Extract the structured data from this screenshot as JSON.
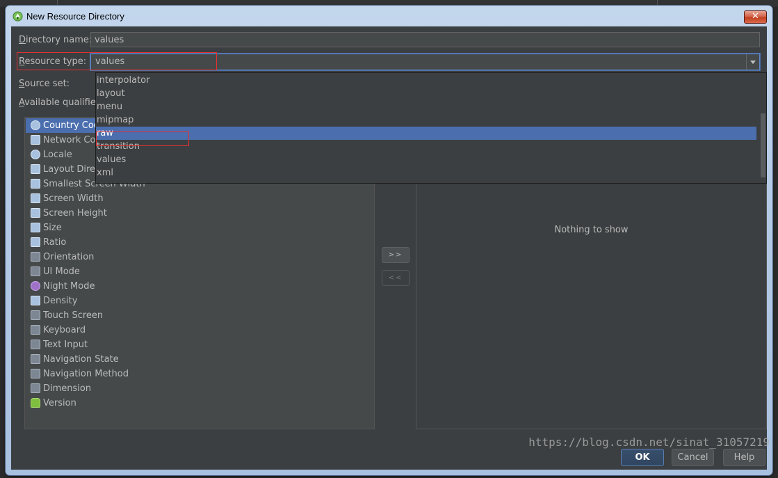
{
  "window": {
    "title": "New Resource Directory",
    "close_label": "✕"
  },
  "form": {
    "directory_name_label": "Directory name:",
    "directory_name_value": "values",
    "resource_type_label": "Resource type:",
    "resource_type_value": "values",
    "source_set_label": "Source set:",
    "available_qualifiers_label": "Available qualifier"
  },
  "dropdown": {
    "items": [
      "interpolator",
      "layout",
      "menu",
      "mipmap",
      "raw",
      "transition",
      "values",
      "xml"
    ],
    "selected": "raw"
  },
  "qualifiers": [
    {
      "label": "Country Code",
      "icon": "globe-pin-icon",
      "selected": true
    },
    {
      "label": "Network Code",
      "icon": "network-icon"
    },
    {
      "label": "Locale",
      "icon": "globe-icon"
    },
    {
      "label": "Layout Direction",
      "icon": "layout-direction-icon"
    },
    {
      "label": "Smallest Screen Width",
      "icon": "smallest-width-icon"
    },
    {
      "label": "Screen Width",
      "icon": "screen-width-icon"
    },
    {
      "label": "Screen Height",
      "icon": "screen-height-icon"
    },
    {
      "label": "Size",
      "icon": "size-icon"
    },
    {
      "label": "Ratio",
      "icon": "ratio-icon"
    },
    {
      "label": "Orientation",
      "icon": "orientation-icon"
    },
    {
      "label": "UI Mode",
      "icon": "ui-mode-icon"
    },
    {
      "label": "Night Mode",
      "icon": "night-mode-icon"
    },
    {
      "label": "Density",
      "icon": "density-icon"
    },
    {
      "label": "Touch Screen",
      "icon": "touch-screen-icon"
    },
    {
      "label": "Keyboard",
      "icon": "keyboard-icon"
    },
    {
      "label": "Text Input",
      "icon": "text-input-icon"
    },
    {
      "label": "Navigation State",
      "icon": "navigation-state-icon"
    },
    {
      "label": "Navigation Method",
      "icon": "navigation-method-icon"
    },
    {
      "label": "Dimension",
      "icon": "dimension-icon"
    },
    {
      "label": "Version",
      "icon": "android-version-icon"
    }
  ],
  "buttons": {
    "add": ">>",
    "remove": "<<",
    "ok": "OK",
    "cancel": "Cancel",
    "help": "Help"
  },
  "chosen": {
    "empty_text": "Nothing to show"
  },
  "watermark": "https://blog.csdn.net/sinat_31057219",
  "colors": {
    "selection": "#4b6eaf",
    "highlight_box": "#e03131",
    "background": "#3c3f41"
  }
}
